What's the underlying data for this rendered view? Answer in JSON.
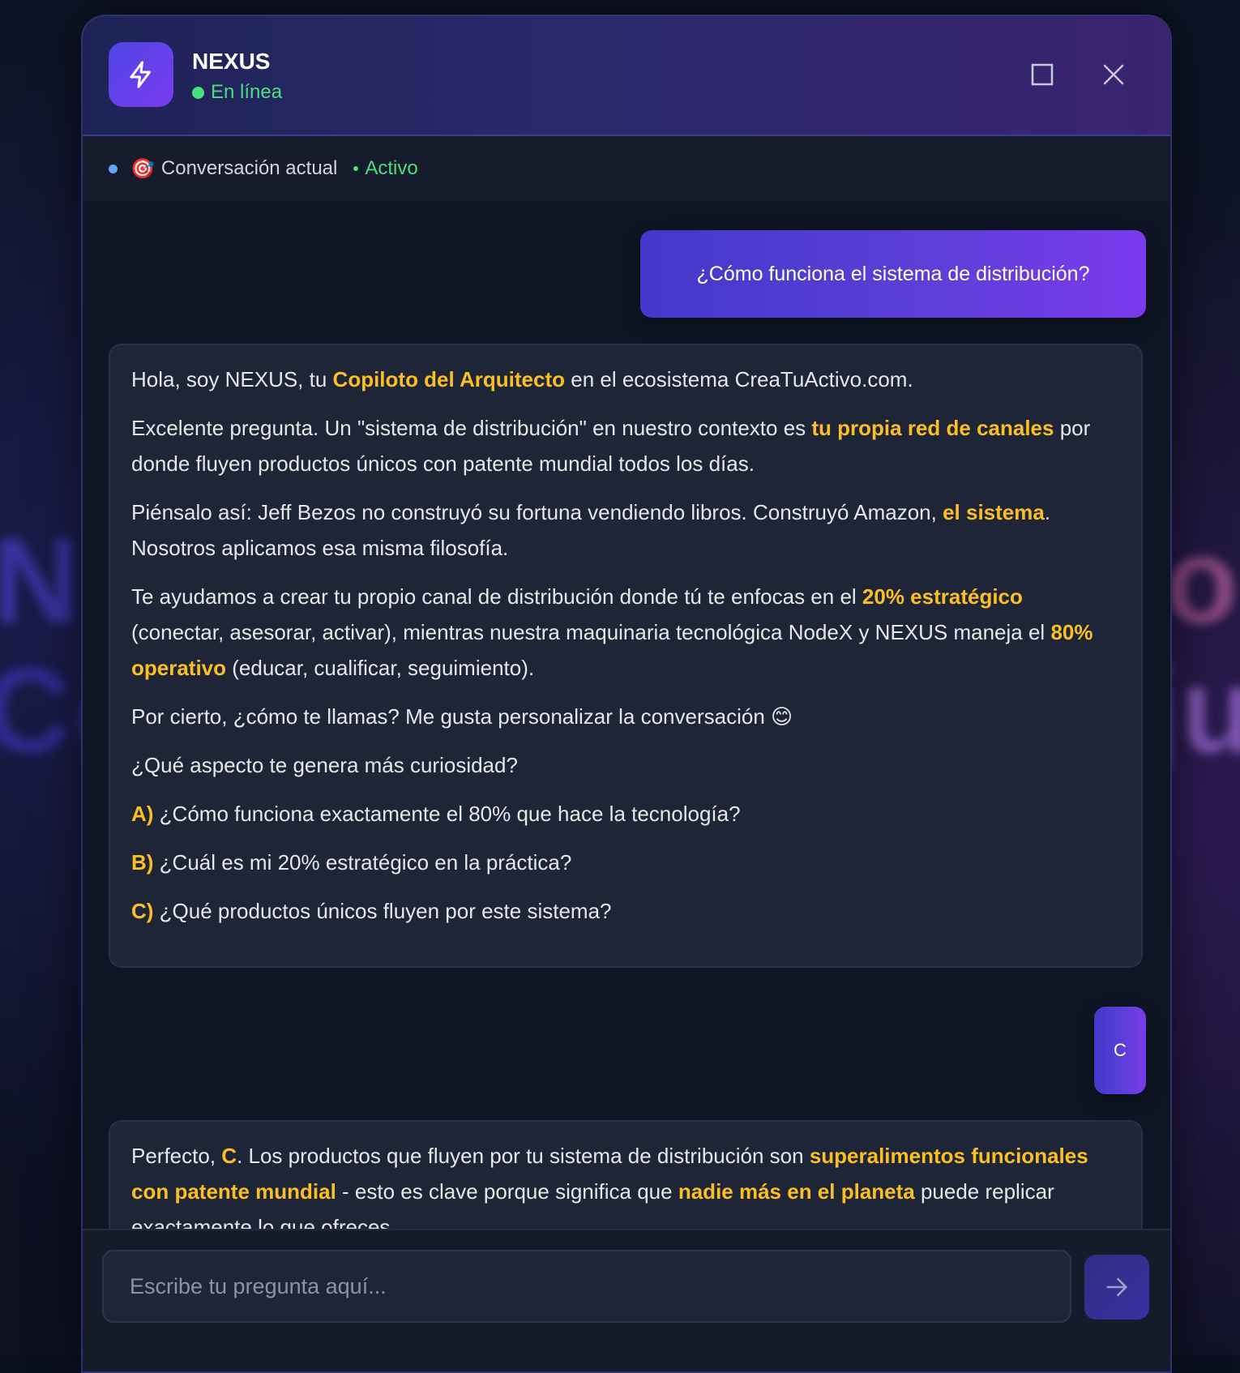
{
  "background": {
    "left_line1": "Ne",
    "left_line2": "Co",
    "right_line1": "o",
    "right_line2": "ju"
  },
  "header": {
    "title": "NEXUS",
    "status": "En línea",
    "logo_icon": "bolt-icon",
    "maximize_icon": "maximize-icon",
    "close_icon": "close-icon"
  },
  "conversation_bar": {
    "icon": "🎯",
    "label": "Conversación actual",
    "status": "Activo"
  },
  "messages": {
    "user_1": "¿Cómo funciona el sistema de distribución?",
    "bot_1": {
      "p1": {
        "a": "Hola, soy NEXUS, tu ",
        "hl": "Copiloto del Arquitecto",
        "b": " en el ecosistema CreaTuActivo.com."
      },
      "p2": {
        "a": "Excelente pregunta. Un \"sistema de distribución\" en nuestro contexto es ",
        "hl": "tu propia red de canales",
        "b": " por donde fluyen productos únicos con patente mundial todos los días."
      },
      "p3": {
        "a": "Piénsalo así: Jeff Bezos no construyó su fortuna vendiendo libros. Construyó Amazon, ",
        "hl": "el sistema",
        "b": ". Nosotros aplicamos esa misma filosofía."
      },
      "p4": {
        "a": "Te ayudamos a crear tu propio canal de distribución donde tú te enfocas en el ",
        "hl1": "20% estratégico",
        "b": " (conectar, asesorar, activar), mientras nuestra maquinaria tecnológica NodeX y NEXUS maneja el ",
        "hl2": "80% operativo",
        "c": " (educar, cualificar, seguimiento)."
      },
      "p5": "Por cierto, ¿cómo te llamas? Me gusta personalizar la conversación 😊",
      "p6": "¿Qué aspecto te genera más curiosidad?",
      "options": [
        {
          "letter": "A)",
          "text": " ¿Cómo funciona exactamente el 80% que hace la tecnología?"
        },
        {
          "letter": "B)",
          "text": " ¿Cuál es mi 20% estratégico en la práctica?"
        },
        {
          "letter": "C)",
          "text": " ¿Qué productos únicos fluyen por este sistema?"
        }
      ]
    },
    "user_2": "C",
    "bot_2": {
      "a": "Perfecto, ",
      "hl1": "C",
      "b": ". Los productos que fluyen por tu sistema de distribución son ",
      "hl2": "superalimentos funcionales con patente mundial",
      "c": " - esto es clave porque significa que ",
      "hl3": "nadie más en el planeta",
      "d": " puede replicar exactamente lo que ofreces."
    }
  },
  "input": {
    "placeholder": "Escribe tu pregunta aquí...",
    "value": "",
    "send_icon": "arrow-right-icon"
  },
  "colors": {
    "accent": "#4f46e5",
    "highlight": "#fbbf24",
    "online": "#4ade80"
  }
}
